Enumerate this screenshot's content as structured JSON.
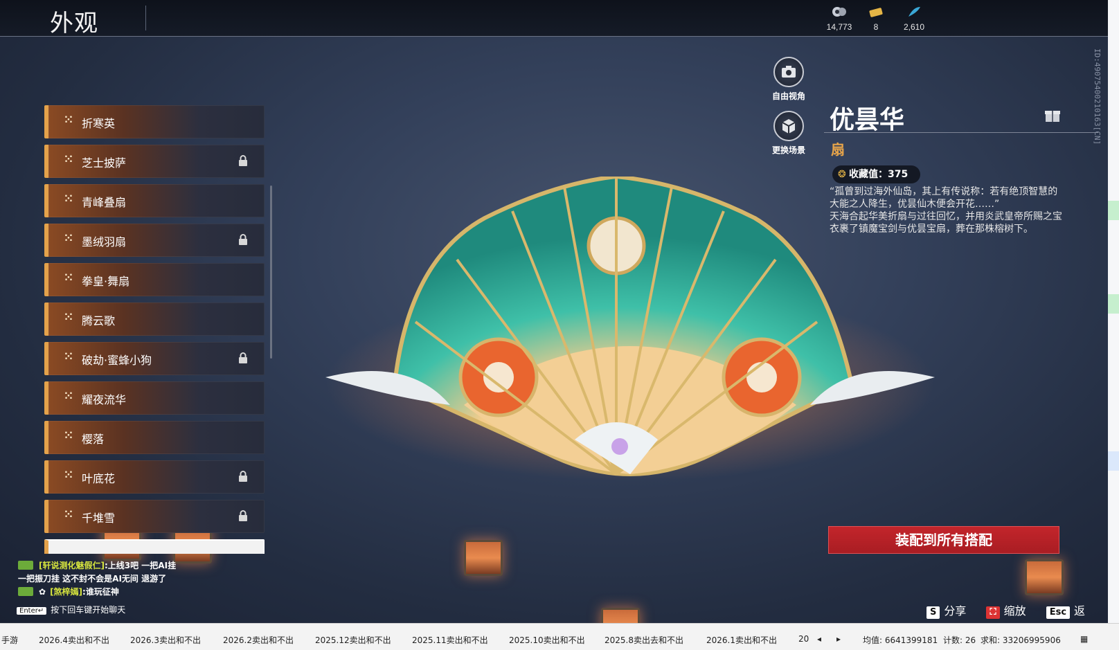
{
  "header": {
    "title": "外观"
  },
  "currencies": [
    {
      "icon": "spirit-icon",
      "value": "14,773"
    },
    {
      "icon": "ticket-icon",
      "value": "8"
    },
    {
      "icon": "feather-icon",
      "value": "2,610"
    }
  ],
  "list": {
    "items": [
      {
        "label": "折寒英",
        "locked": false
      },
      {
        "label": "芝士披萨",
        "locked": true
      },
      {
        "label": "青峰叠扇",
        "locked": false
      },
      {
        "label": "墨绒羽扇",
        "locked": true
      },
      {
        "label": "拳皇·舞扇",
        "locked": false
      },
      {
        "label": "腾云歌",
        "locked": false
      },
      {
        "label": "破劫·蜜蜂小狗",
        "locked": true
      },
      {
        "label": "耀夜流华",
        "locked": false
      },
      {
        "label": "樱落",
        "locked": false
      },
      {
        "label": "叶底花",
        "locked": true
      },
      {
        "label": "千堆雪",
        "locked": true
      }
    ]
  },
  "side_buttons": {
    "free_view": "自由视角",
    "change_scene": "更换场景"
  },
  "detail": {
    "name": "优昙华",
    "type": "扇",
    "collection_label": "收藏值：375",
    "description": "“孤曾到过海外仙岛，其上有传说称：若有绝顶智慧的大能之人降生，优昙仙木便会开花……”\n天海合起华美折扇与过往回忆，并用炎武皇帝所赐之宝衣裹了镇魔宝剑与优昙宝扇，葬在那株榕树下。",
    "equip_button": "装配到所有搭配",
    "vertical_id": "ID:49075400210163[CN]"
  },
  "chat": {
    "lines": [
      {
        "name": "[轩说测化魅假仁]",
        "text": ":上线3吧 一把AI挂"
      },
      {
        "name": "",
        "text": "一把振刀挂 这不封不会是AI无间 退游了"
      },
      {
        "name": "[煞梓嫣]",
        "text": ":谁玩征神"
      }
    ],
    "enter_key": "Enter↵",
    "enter_hint": "按下回车键开始聊天"
  },
  "hints": [
    {
      "key": "S",
      "label": "分享"
    },
    {
      "key": "⛶",
      "label": "缩放"
    },
    {
      "key": "Esc",
      "label": "返回"
    }
  ],
  "sheet": {
    "tabs": [
      "手游",
      "2026.4卖出和不出",
      "2026.3卖出和不出",
      "2026.2卖出和不出",
      "2025.12卖出和不出",
      "2025.11卖出和不出",
      "2025.10卖出和不出",
      "2025.8卖出去和不出",
      "2026.1卖出和不出",
      "20"
    ],
    "avg": "均值: 6641399181",
    "count": "计数: 26",
    "sum": "求和: 33206995906"
  },
  "colors": {
    "accent": "#e4a24b",
    "equip": "#c3252b",
    "type_text": "#e8a54a"
  }
}
